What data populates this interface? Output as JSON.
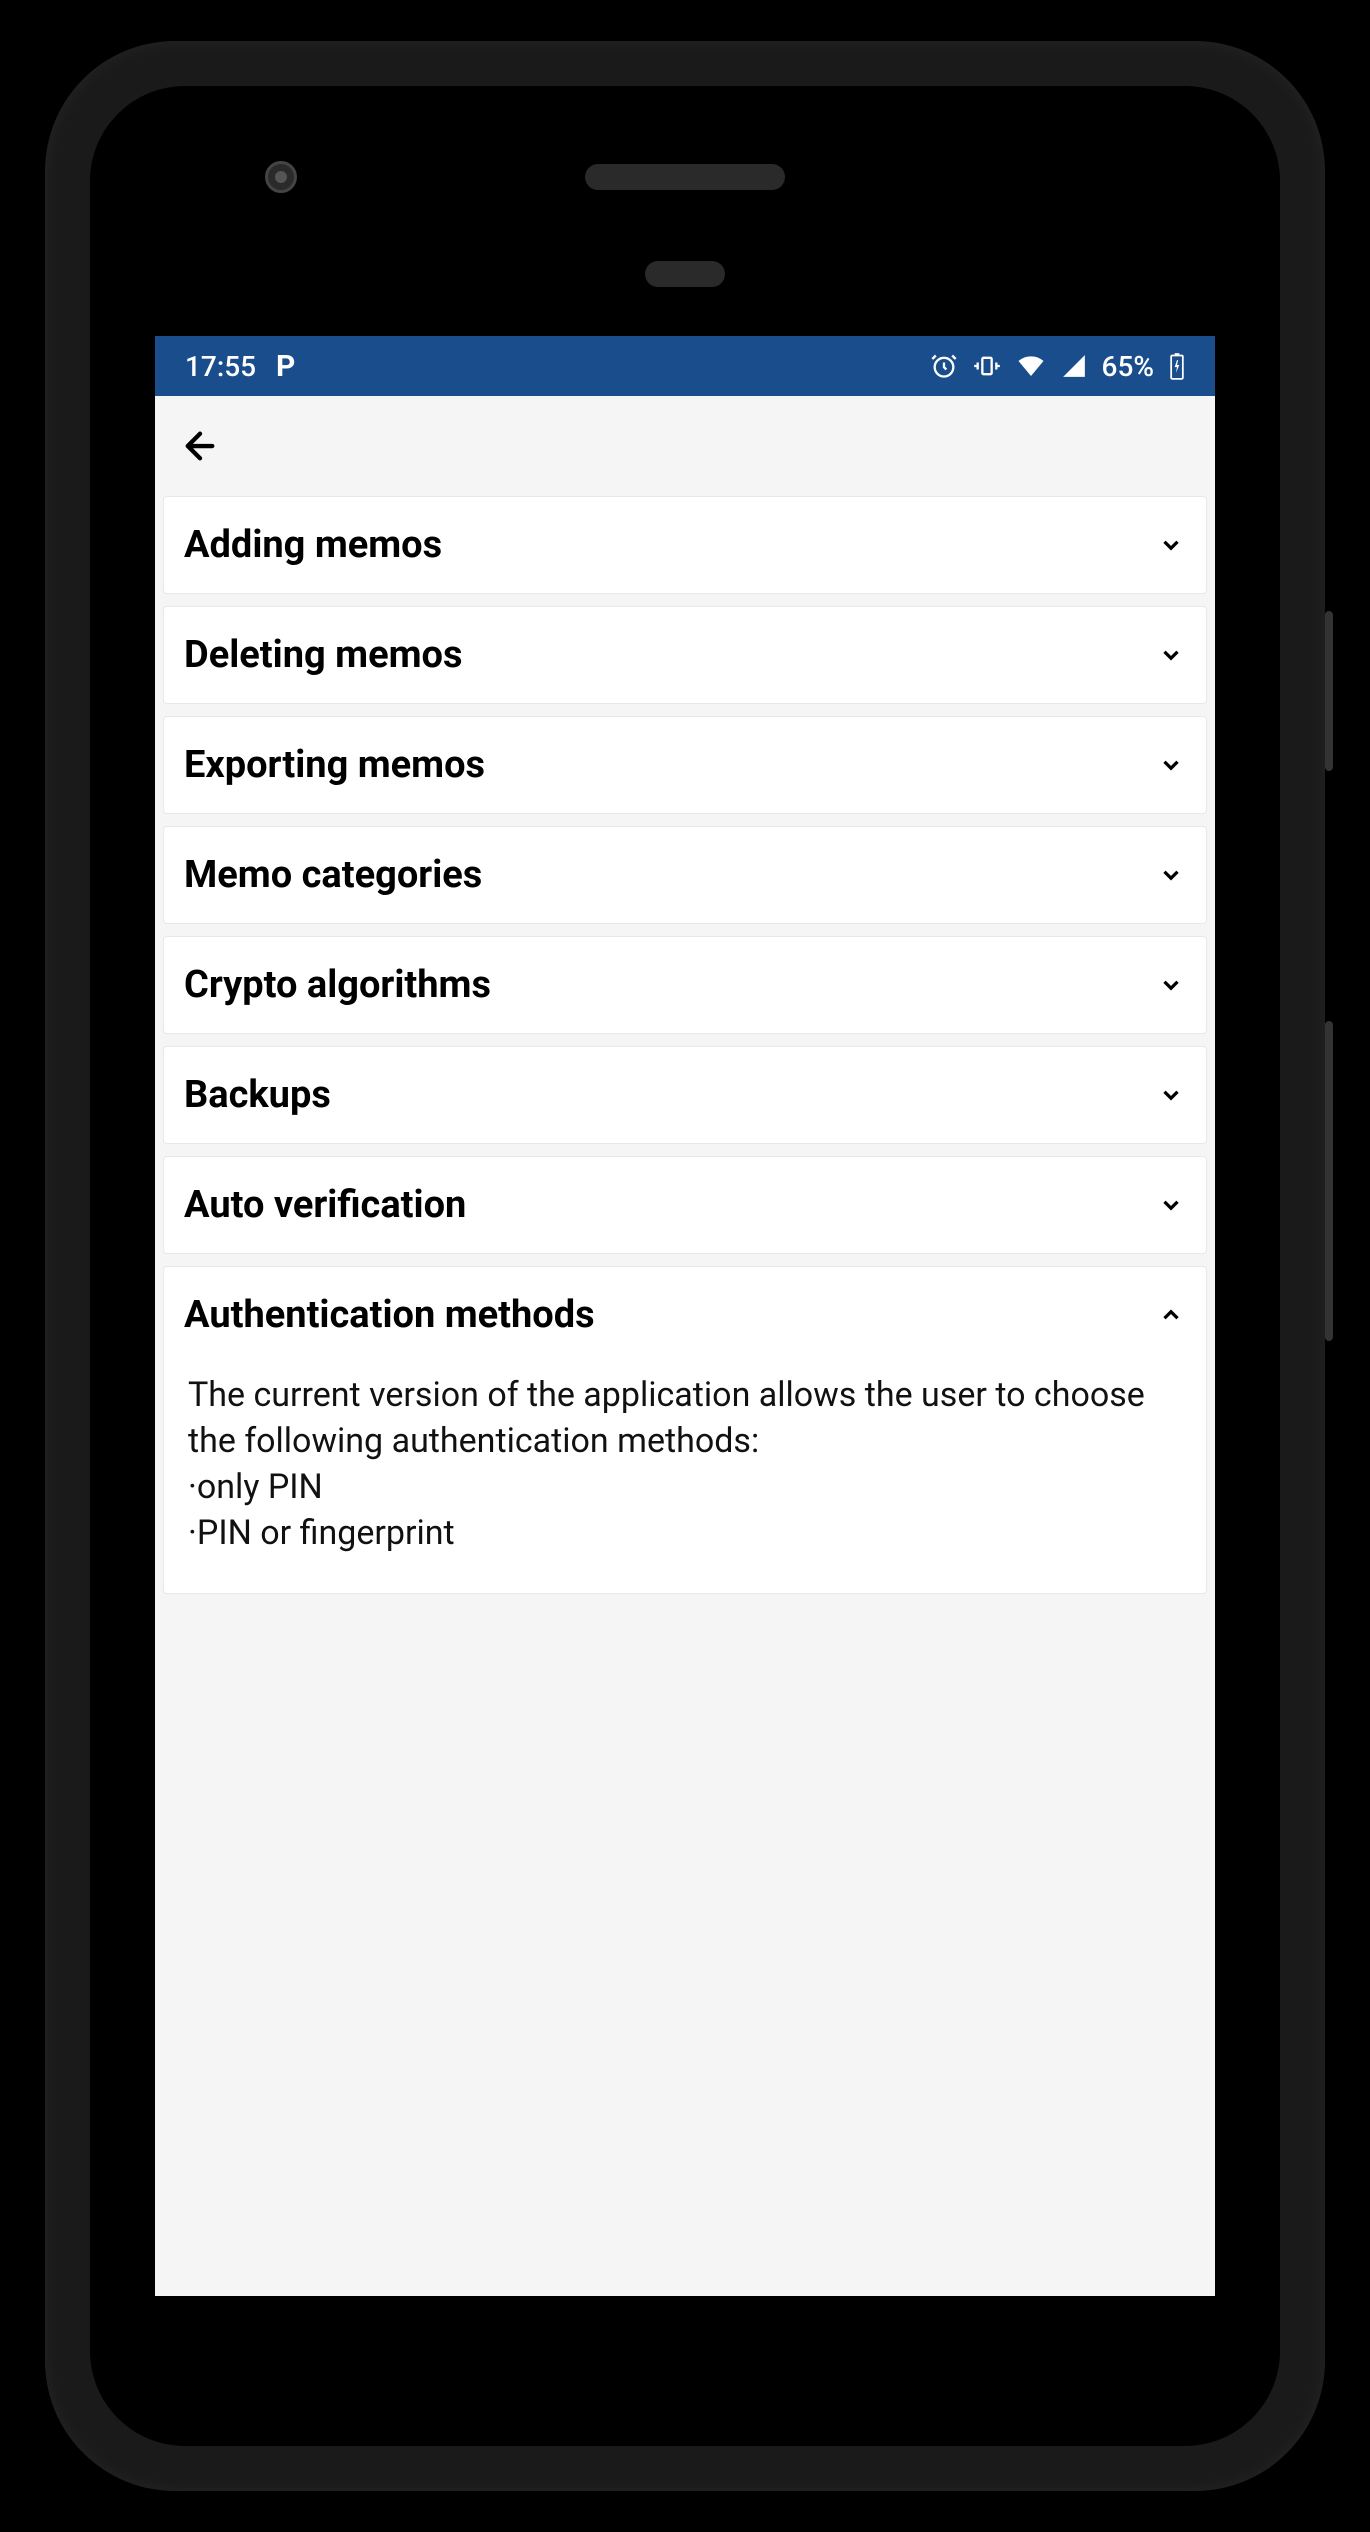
{
  "statusBar": {
    "time": "17:55",
    "battery": "65%"
  },
  "accordion": {
    "items": [
      {
        "title": "Adding memos",
        "expanded": false
      },
      {
        "title": "Deleting memos",
        "expanded": false
      },
      {
        "title": "Exporting memos",
        "expanded": false
      },
      {
        "title": "Memo categories",
        "expanded": false
      },
      {
        "title": "Crypto algorithms",
        "expanded": false
      },
      {
        "title": "Backups",
        "expanded": false
      },
      {
        "title": "Auto verification",
        "expanded": false
      },
      {
        "title": "Authentication methods",
        "expanded": true,
        "body": "The current version of the application allows the user to choose the following authentication methods:\n·only PIN\n·PIN or fingerprint"
      }
    ]
  }
}
